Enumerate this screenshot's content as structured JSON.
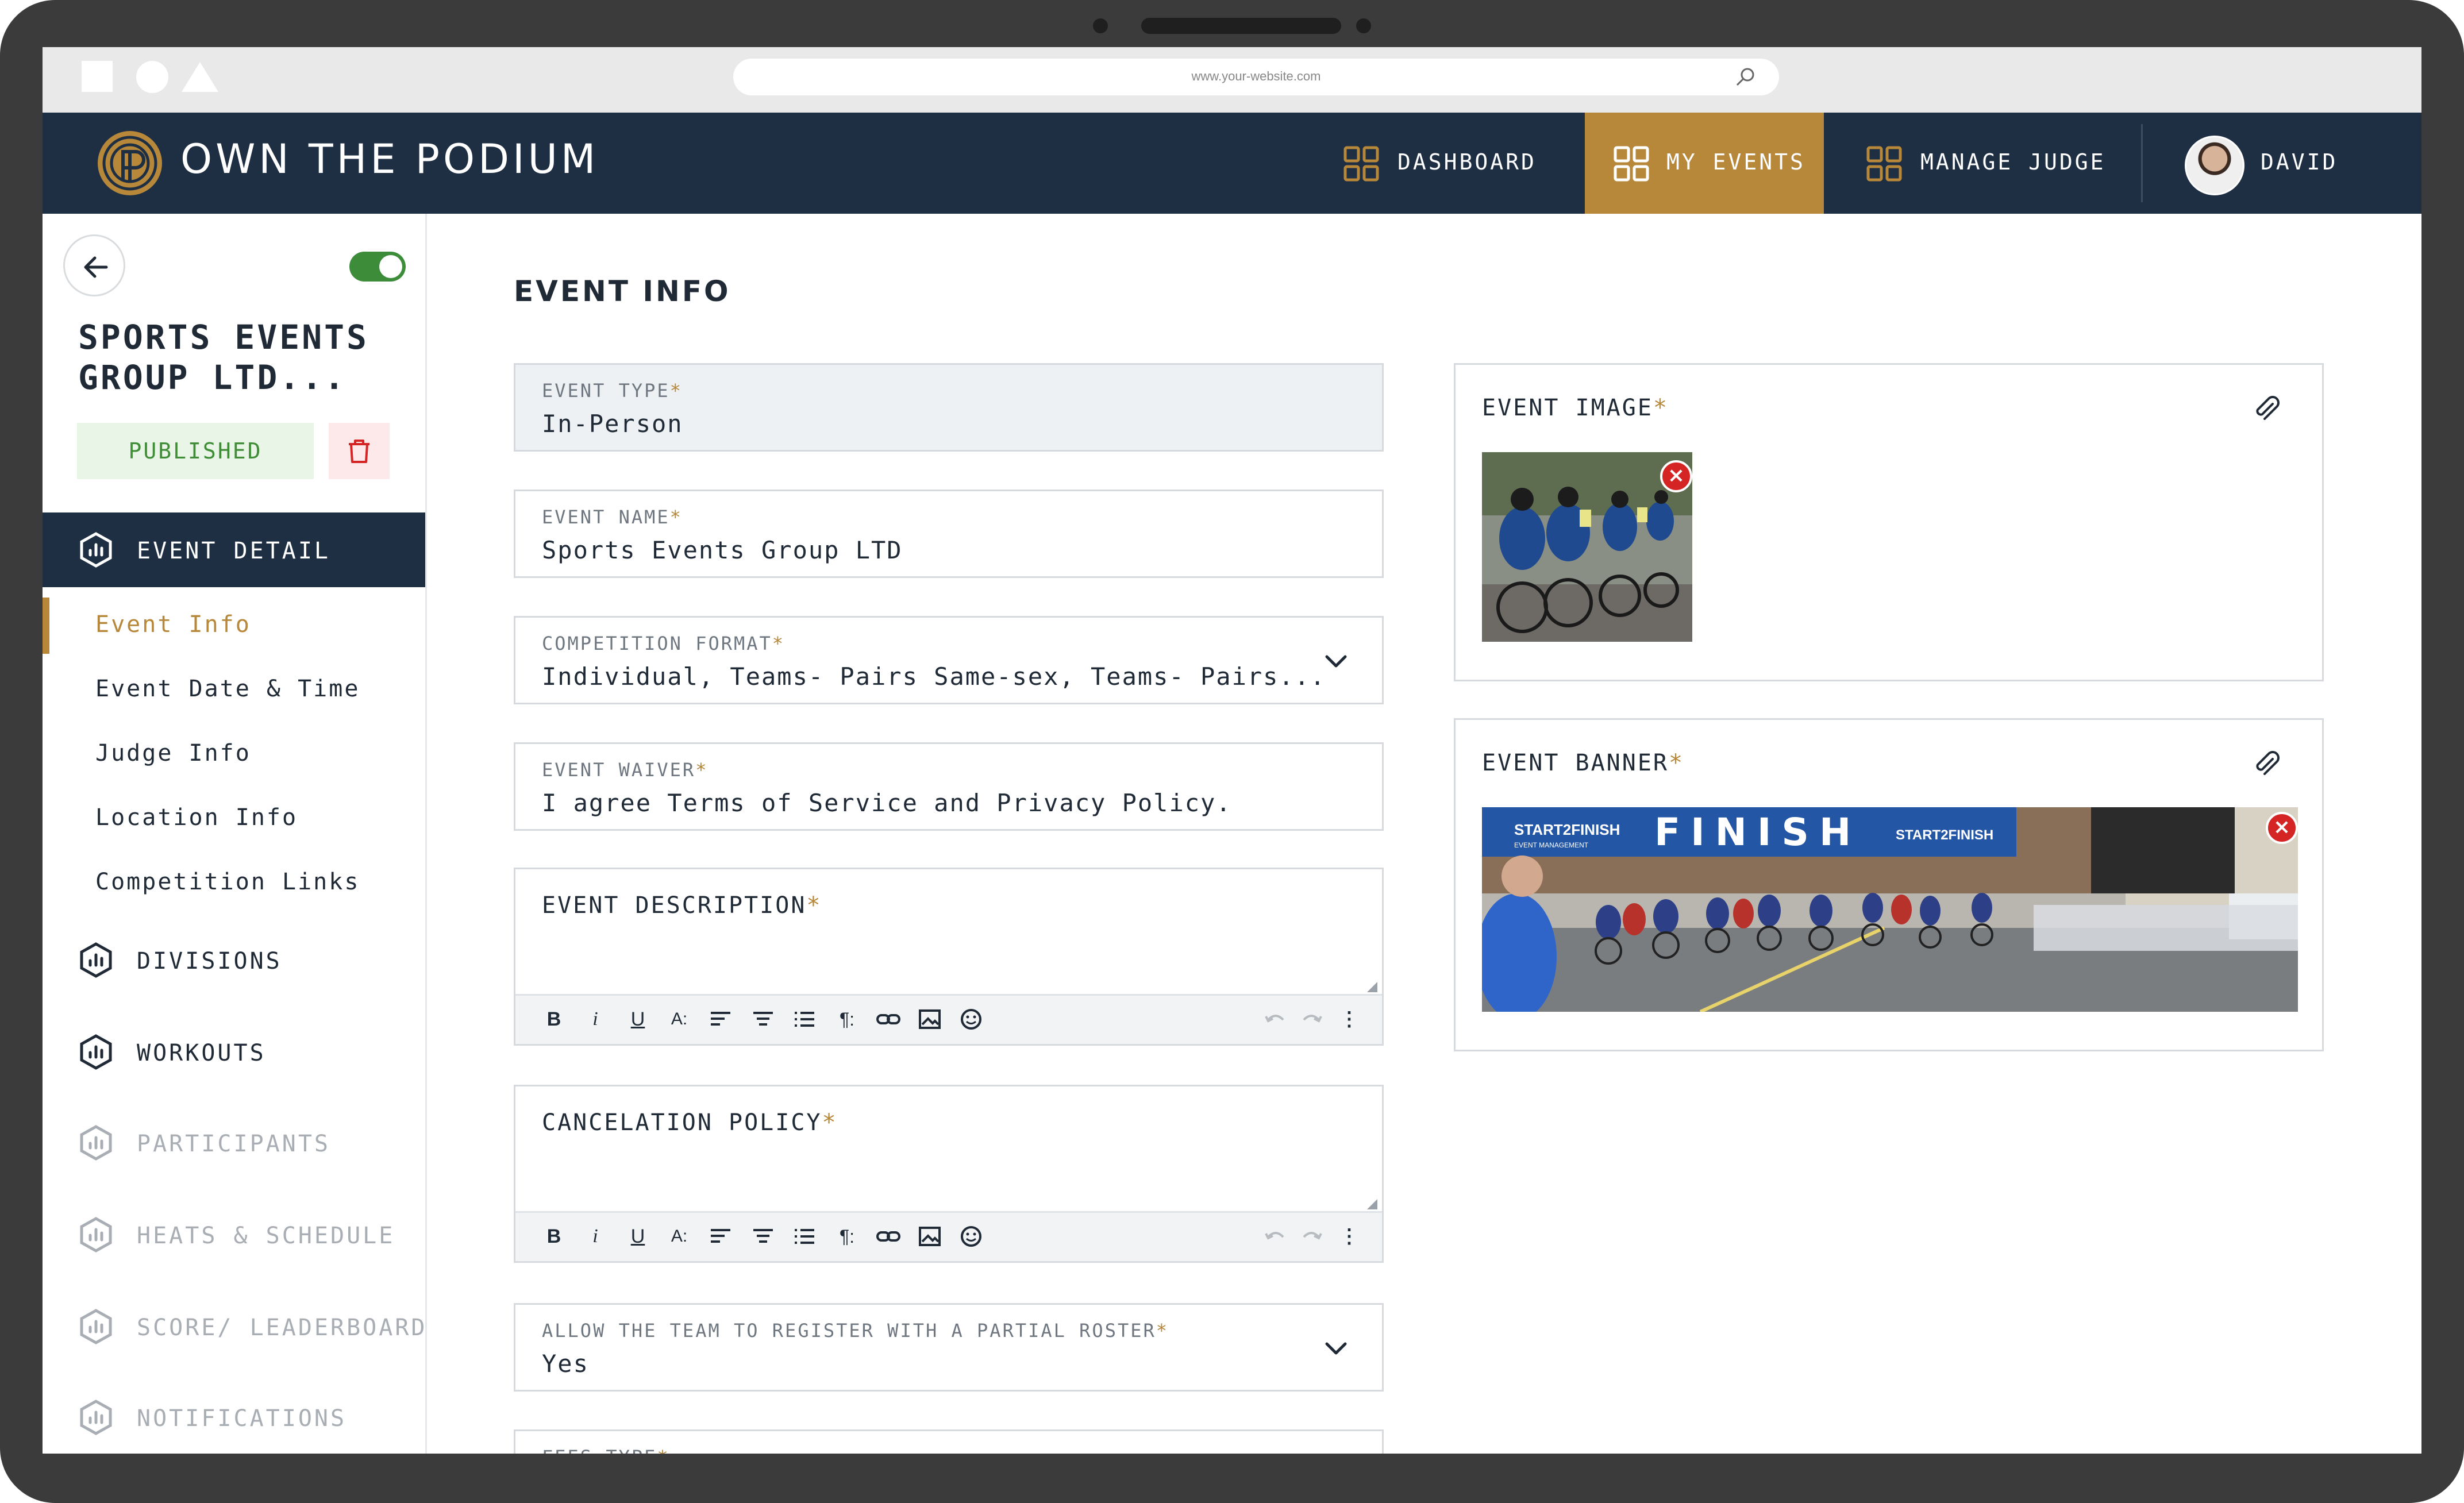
{
  "browser": {
    "url": "www.your-website.com"
  },
  "header": {
    "brand": "OWN THE PODIUM",
    "nav": {
      "dashboard": "DASHBOARD",
      "my_events": "MY EVENTS",
      "manage_judge": "MANAGE JUDGE",
      "user": "DAVID"
    },
    "colors": {
      "navy": "#1e2f43",
      "gold": "#b7873a"
    }
  },
  "sidebar": {
    "event_title": "SPORTS EVENTS GROUP LTD...",
    "status": "PUBLISHED",
    "publish_toggle_on": true,
    "section_event_detail": "EVENT DETAIL",
    "sub_items": [
      "Event Info",
      "Event Date & Time",
      "Judge Info",
      "Location Info",
      "Competition Links"
    ],
    "sections": [
      "DIVISIONS",
      "WORKOUTS",
      "PARTICIPANTS",
      "HEATS & SCHEDULE",
      "SCORE/ LEADERBOARD",
      "NOTIFICATIONS"
    ]
  },
  "main": {
    "title": "EVENT INFO",
    "fields": {
      "event_type": {
        "label": "EVENT TYPE",
        "value": "In-Person"
      },
      "event_name": {
        "label": "EVENT NAME",
        "value": "Sports Events Group LTD"
      },
      "competition_format": {
        "label": "COMPETITION FORMAT",
        "value": "Individual, Teams- Pairs Same-sex, Teams- Pairs..."
      },
      "event_waiver": {
        "label": "EVENT WAIVER",
        "value": "I agree Terms of Service and Privacy Policy."
      },
      "event_description": {
        "label": "EVENT DESCRIPTION"
      },
      "cancelation_policy": {
        "label": "CANCELATION POLICY"
      },
      "partial_roster": {
        "label": "ALLOW THE TEAM TO REGISTER WITH A PARTIAL ROSTER",
        "value": "Yes"
      },
      "fees_type": {
        "label": "FEES TYPE"
      }
    },
    "required_mark": "*",
    "toolbar": {
      "bold": "B",
      "italic": "i",
      "underline": "U",
      "font_size": "A:",
      "paragraph": "¶:",
      "more": "⋮"
    },
    "event_image": {
      "label": "EVENT IMAGE"
    },
    "event_banner": {
      "label": "EVENT BANNER",
      "text": "FINISH",
      "sponsor": "START2FINISH",
      "sponsor_sub": "EVENT MANAGEMENT"
    }
  }
}
